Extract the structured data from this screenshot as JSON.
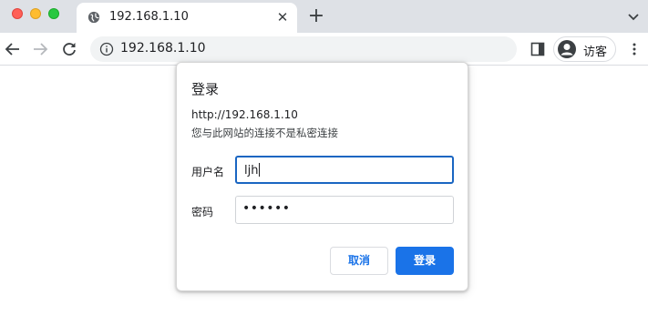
{
  "browser": {
    "tab": {
      "title": "192.168.1.10",
      "close_glyph": "✕",
      "icon": "globe-icon"
    },
    "new_tab_glyph": "+",
    "address": {
      "url": "192.168.1.10",
      "icon": "info-icon"
    },
    "profile": {
      "label": "访客",
      "icon": "avatar-icon"
    }
  },
  "dialog": {
    "title": "登录",
    "origin": "http://192.168.1.10",
    "warning": "您与此网站的连接不是私密连接",
    "username": {
      "label": "用户名",
      "value": "ljh"
    },
    "password": {
      "label": "密码",
      "value": "••••••"
    },
    "buttons": {
      "cancel": "取消",
      "login": "登录"
    }
  },
  "colors": {
    "accent": "#1a73e8",
    "focus_border": "#1a66c2",
    "tabstrip": "#dee1e6",
    "omnibox": "#f1f3f4"
  }
}
